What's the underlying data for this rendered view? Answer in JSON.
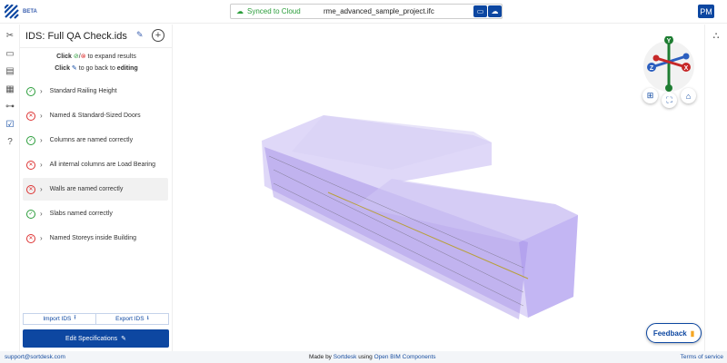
{
  "header": {
    "beta": "BETA",
    "sync_status": "Synced to Cloud",
    "file_name": "rme_advanced_sample_project.ifc",
    "avatar": "PM"
  },
  "rail": {
    "icons": [
      "scissors-icon",
      "ruler-icon",
      "document-icon",
      "table-icon",
      "tree-icon",
      "checklist-icon",
      "help-icon"
    ]
  },
  "panel": {
    "title": "IDS: Full QA Check.ids",
    "instr1_click": "Click",
    "instr1_sep": "/",
    "instr1_text": "to expand results",
    "instr2_click": "Click",
    "instr2_text": "to go back to",
    "instr2_bold": "editing",
    "items": [
      {
        "label": "Standard Railing Height",
        "status": "pass"
      },
      {
        "label": "Named & Standard-Sized Doors",
        "status": "fail"
      },
      {
        "label": "Columns are named correctly",
        "status": "pass"
      },
      {
        "label": "All internal columns are Load Bearing",
        "status": "fail"
      },
      {
        "label": "Walls are named correctly",
        "status": "fail",
        "selected": true
      },
      {
        "label": "Slabs named correctly",
        "status": "pass"
      },
      {
        "label": "Named Storeys inside Building",
        "status": "fail"
      }
    ],
    "import": "Import IDS",
    "export": "Export IDS",
    "edit": "Edit Specifications"
  },
  "compass": {
    "y": "Y",
    "x": "X",
    "z": "Z"
  },
  "feedback": "Feedback",
  "footer": {
    "email": "support@sortdesk.com",
    "made_by": "Made by",
    "sortdesk": "Sortdesk",
    "using": "using",
    "obc": "Open BIM Components",
    "terms": "Terms of service"
  },
  "colors": {
    "brand": "#0d47a1",
    "pass": "#2a9d3a",
    "fail": "#d33",
    "model": "#8a6fe0"
  }
}
